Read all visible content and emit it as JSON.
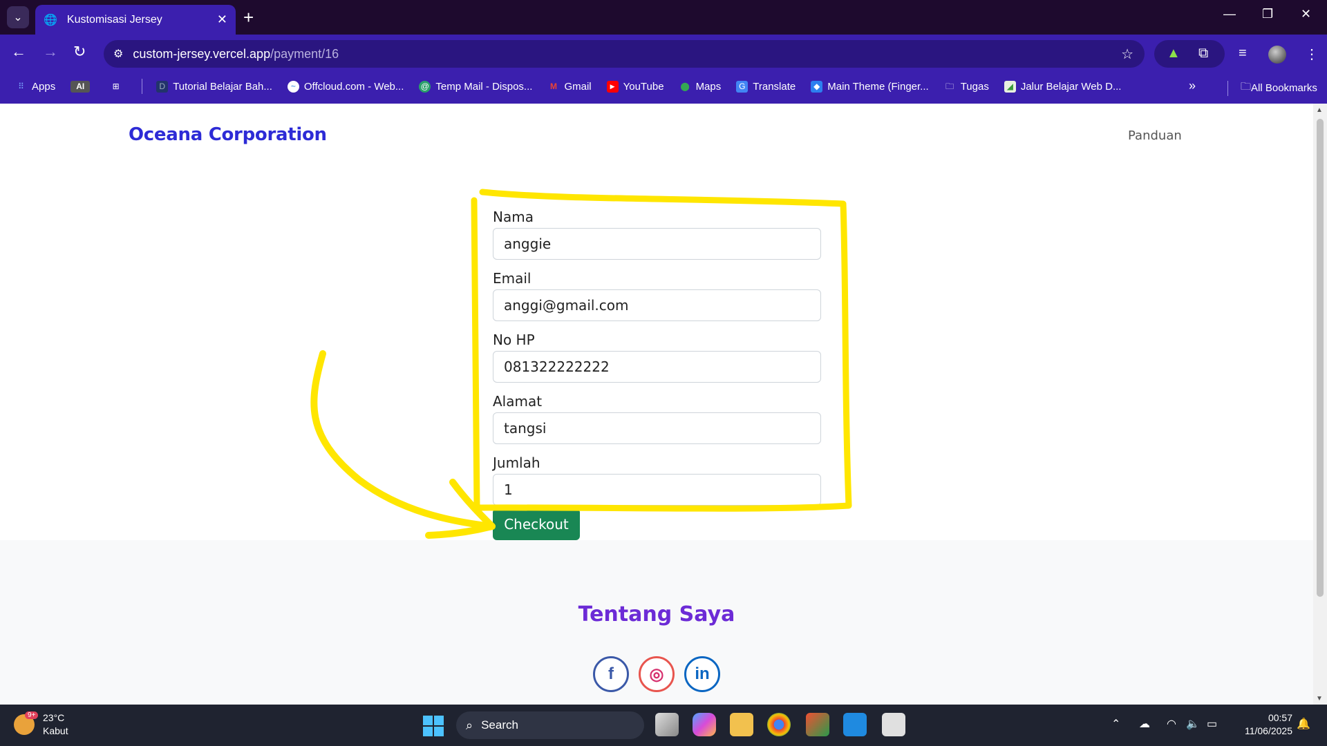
{
  "browser": {
    "tab_title": "Kustomisasi Jersey",
    "url_host": "custom-jersey.vercel.app",
    "url_path": "/payment/16",
    "bookmarks": [
      {
        "label": "Apps",
        "icon": "apps-grid-icon"
      },
      {
        "label": "AI",
        "icon": "ai-badge-icon"
      },
      {
        "label": "Tutorial Belajar Bah...",
        "icon": "dicoding-icon"
      },
      {
        "label": "Offcloud.com - Web...",
        "icon": "offcloud-icon"
      },
      {
        "label": "Temp Mail - Dispos...",
        "icon": "tempmail-icon"
      },
      {
        "label": "Gmail",
        "icon": "gmail-icon"
      },
      {
        "label": "YouTube",
        "icon": "youtube-icon"
      },
      {
        "label": "Maps",
        "icon": "maps-icon"
      },
      {
        "label": "Translate",
        "icon": "translate-icon"
      },
      {
        "label": "Main Theme (Finger...",
        "icon": "theme-icon"
      },
      {
        "label": "Tugas",
        "icon": "folder-icon"
      },
      {
        "label": "Jalur Belajar Web D...",
        "icon": "learning-path-icon"
      }
    ],
    "all_bookmarks": "All Bookmarks"
  },
  "page": {
    "brand": "Oceana Corporation",
    "nav_link": "Panduan",
    "form": {
      "fields": [
        {
          "label": "Nama",
          "value": "anggie"
        },
        {
          "label": "Email",
          "value": "anggi@gmail.com"
        },
        {
          "label": "No HP",
          "value": "081322222222"
        },
        {
          "label": "Alamat",
          "value": "tangsi"
        },
        {
          "label": "Jumlah",
          "value": "1"
        }
      ],
      "submit": "Checkout"
    },
    "footer": {
      "title": "Tentang Saya",
      "social": [
        {
          "label": "f",
          "icon": "facebook-icon"
        },
        {
          "label": "◎",
          "icon": "instagram-icon"
        },
        {
          "label": "in",
          "icon": "linkedin-icon"
        }
      ]
    }
  },
  "annotation_color": "#ffe600",
  "taskbar": {
    "weather_temp": "23°C",
    "weather_desc": "Kabut",
    "weather_badge": "9+",
    "search_label": "Search",
    "time": "00:57",
    "date": "11/06/2025"
  },
  "colors": {
    "chrome": "#3b1fae",
    "titlebar": "#1e0a2e",
    "brand": "#2d2bd6",
    "checkout": "#198754"
  }
}
